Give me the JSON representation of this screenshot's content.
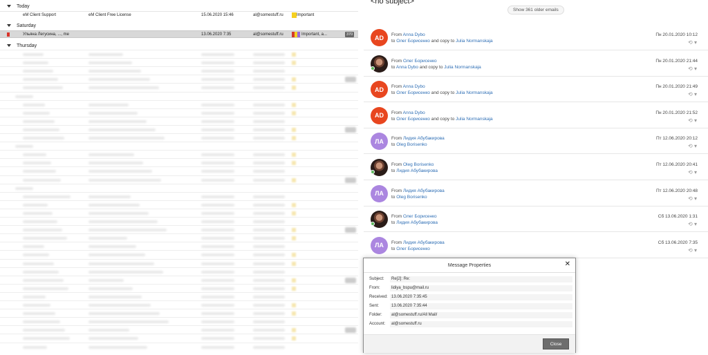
{
  "groups": {
    "today": "Today",
    "saturday": "Saturday",
    "thursday": "Thursday"
  },
  "rows": [
    {
      "from": "eM Client Support",
      "subject": "eM Client Free License",
      "date": "15.06.2020 15:46",
      "account": "al@somestuff.ru",
      "category": "Important"
    },
    {
      "from": "Ульяна Легусина, ..., me",
      "subject": "",
      "date": "13.06.2020 7:35",
      "account": "al@somestuff.ru",
      "category": "Important, a...",
      "count": "370"
    }
  ],
  "conversation": {
    "title": "<no subject>",
    "older_label": "Show 361 older emails",
    "messages": [
      {
        "avatar": "AD",
        "type": "ad",
        "from": "Anna Dybo",
        "to": "Олег Борисенко",
        "cc": "Julia Normanskaja",
        "date": "Пн 20.01.2020 10:12"
      },
      {
        "avatar": "",
        "type": "photo",
        "from": "Олег Борисенко",
        "to": "Anna Dybo",
        "cc": "Julia Normanskaja",
        "date": "Пн 20.01.2020 21:44"
      },
      {
        "avatar": "AD",
        "type": "ad",
        "from": "Anna Dybo",
        "to": "Олег Борисенко",
        "cc": "Julia Normanskaja",
        "date": "Пн 20.01.2020 21:49"
      },
      {
        "avatar": "AD",
        "type": "ad",
        "from": "Anna Dybo",
        "to": "Олег Борисенко",
        "cc": "Julia Normanskaja",
        "date": "Пн 20.01.2020 21:52"
      },
      {
        "avatar": "ЛА",
        "type": "la",
        "from": "Лидия Абубакирова",
        "to": "Oleg Borisenko",
        "cc": "",
        "date": "Пт 12.06.2020 20:12"
      },
      {
        "avatar": "",
        "type": "photo",
        "from": "Oleg Borisenko",
        "to": "Лидия Абубакирова",
        "cc": "",
        "date": "Пт 12.06.2020 20:41"
      },
      {
        "avatar": "ЛА",
        "type": "la",
        "from": "Лидия Абубакирова",
        "to": "Oleg Borisenko",
        "cc": "",
        "date": "Пт 12.06.2020 20:48"
      },
      {
        "avatar": "",
        "type": "photo",
        "from": "Олег Борисенко",
        "to": "Лидия Абубакирова",
        "cc": "",
        "date": "Сб 13.06.2020 1:31"
      },
      {
        "avatar": "ЛА",
        "type": "la",
        "from": "Лидия Абубакирова",
        "to": "Олег Борисенко",
        "cc": "",
        "date": "Сб 13.06.2020 7:35"
      }
    ],
    "labels": {
      "from": "From",
      "to": "to",
      "and_copy": "and copy to"
    }
  },
  "dialog": {
    "title": "Message Properties",
    "close_symbol": "✕",
    "fields": [
      {
        "label": "Subject:",
        "value": "Re[2]: Re:"
      },
      {
        "label": "From:",
        "value": "lidiya_bspu@mail.ru"
      },
      {
        "label": "Received:",
        "value": "13.06.2020 7:35:45"
      },
      {
        "label": "Sent:",
        "value": "13.06.2020 7:35:44"
      },
      {
        "label": "Folder:",
        "value": "al@somestuff.ru/All Mail/"
      },
      {
        "label": "Account:",
        "value": "al@somestuff.ru"
      }
    ],
    "close_label": "Close"
  },
  "colors": {
    "important": "#f5d020",
    "purple_tag": "#9b6ad6",
    "red_tag": "#d33b2c",
    "flag": "#d9342b",
    "avatar_ad": "#e8461f",
    "avatar_la": "#ab86e0",
    "link": "#2f6fb5"
  }
}
